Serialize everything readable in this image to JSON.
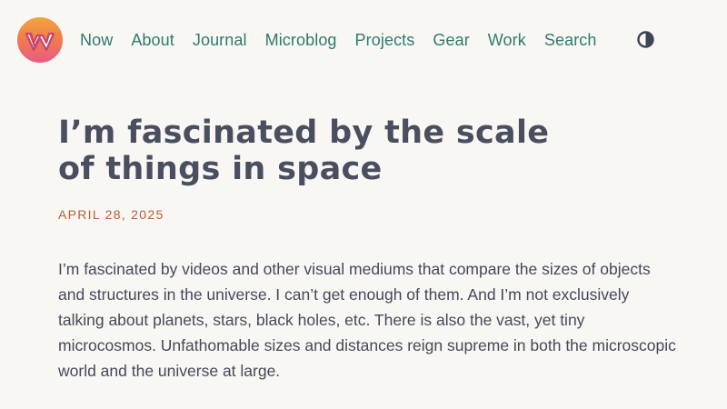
{
  "header": {
    "logo_label": "W",
    "nav": [
      {
        "label": "Now"
      },
      {
        "label": "About"
      },
      {
        "label": "Journal"
      },
      {
        "label": "Microblog"
      },
      {
        "label": "Projects"
      },
      {
        "label": "Gear"
      },
      {
        "label": "Work"
      },
      {
        "label": "Search"
      }
    ],
    "theme_toggle_icon": "half-circle-contrast-icon"
  },
  "article": {
    "title": "I’m fascinated by the scale of things in space",
    "date": "APRIL 28, 2025",
    "paragraph": "I’m fascinated by videos and other visual mediums that compare the sizes of objects and structures in the universe. I can’t get enough of them. And I’m not exclusively talking about planets, stars, black holes, etc. There is also the vast, yet tiny microcosmos. Unfathomable sizes and distances reign supreme in both the microscopic world and the universe at large."
  },
  "colors": {
    "background": "#f8f7f4",
    "nav_link": "#2f7a6e",
    "title": "#4a4f60",
    "date": "#c15a36",
    "body_text": "#46485a",
    "logo_gradient_top": "#f3a53a",
    "logo_gradient_bottom": "#e95a86"
  }
}
